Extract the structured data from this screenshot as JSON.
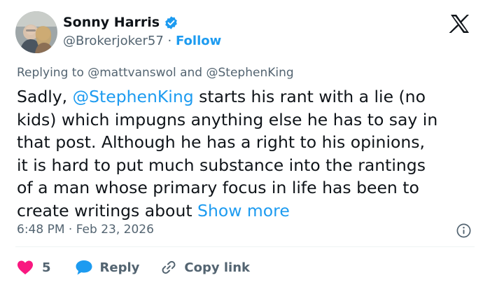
{
  "author": {
    "name": "Sonny Harris",
    "handle": "@Brokerjoker57",
    "separator": " · ",
    "follow_label": "Follow",
    "verified_icon": "verified-badge-icon"
  },
  "replying": {
    "prefix": "Replying to ",
    "user1": "@mattvanswol",
    "joiner": " and ",
    "user2": "@StephenKing"
  },
  "tweet": {
    "line1_pre": "Sadly, ",
    "mention": "@StephenKing",
    "rest": " starts his rant with a lie (no\nkids) which impugns anything else he has to say in\nthat post. Although he has a right to his opinions,\nit is hard to put much substance into the rantings\nof a man whose primary focus in life has been to\ncreate writings about ",
    "show_more": "Show more"
  },
  "timestamp": "6:48 PM · Feb 23, 2026",
  "actions": {
    "like_count": "5",
    "reply_label": "Reply",
    "copy_link_label": "Copy link"
  },
  "colors": {
    "accent": "#1d9bf0",
    "text": "#0f1419",
    "muted": "#536471",
    "like": "#f91880"
  }
}
